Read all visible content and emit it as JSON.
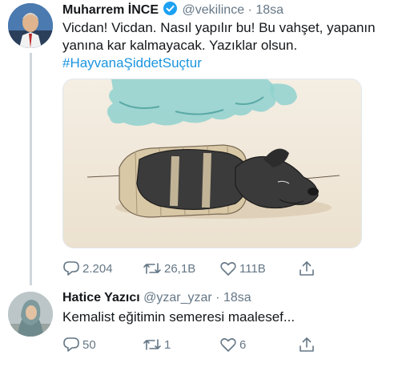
{
  "tweets": [
    {
      "name": "Muharrem İNCE",
      "handle": "@vekilince",
      "separator": "·",
      "time": "18sa",
      "text": "Vicdan! Vicdan. Nasıl yapılır bu! Bu vahşet, yapanın yanına kar kalmayacak. Yazıklar olsun.",
      "hashtag": "#HayvanaŞiddetSuçtur",
      "replies": "2.204",
      "retweets": "26,1B",
      "likes": "111B"
    },
    {
      "name": "Hatice Yazıcı",
      "handle": "@yzar_yzar",
      "separator": "·",
      "time": "18sa",
      "text": "Kemalist eğitimin semeresi maalesef...",
      "replies": "50",
      "retweets": "1",
      "likes": "6"
    }
  ],
  "icons": {
    "reply": "reply-icon",
    "retweet": "retweet-icon",
    "like": "heart-icon",
    "share": "share-icon",
    "verified": "verified-badge-icon"
  },
  "colors": {
    "link": "#1b95e0",
    "muted": "#657786",
    "verified": "#1da1f2",
    "thread_line": "#d0d7dd"
  }
}
